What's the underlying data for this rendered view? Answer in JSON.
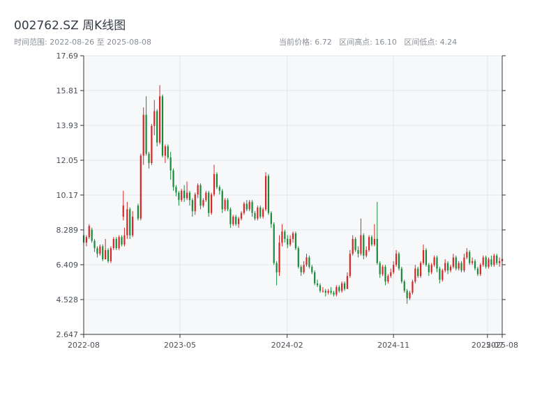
{
  "header": {
    "title": "002762.SZ 周K线图",
    "date_range": "时间范围: 2022-08-26 至 2025-08-08",
    "current_price": "当前价格: 6.72",
    "range_high": "区间高点: 16.10",
    "range_low": "区间低点: 4.24"
  },
  "colors": {
    "up": "#d62728",
    "down": "#1a8a3a",
    "grid": "#e3e6ea",
    "plot_bg": "#f7f8fa",
    "axis": "#333333"
  },
  "chart_data": {
    "type": "candlestick",
    "title": "002762.SZ 周K线图",
    "ylim": [
      2.647,
      17.69
    ],
    "xlim": [
      "2022-08-26",
      "2025-08-08"
    ],
    "y_ticks": [
      "2.647",
      "4.528",
      "6.409",
      "8.289",
      "10.17",
      "12.05",
      "13.93",
      "15.81",
      "17.69"
    ],
    "x_ticks": [
      {
        "label": "2022-08",
        "date": "2022-08-26"
      },
      {
        "label": "2023-05",
        "date": "2023-05-01"
      },
      {
        "label": "2024-02",
        "date": "2024-02-01"
      },
      {
        "label": "2024-11",
        "date": "2024-11-01"
      },
      {
        "label": "2025-07",
        "date": "2025-07-01"
      },
      {
        "label": "2025-08",
        "date": "2025-08-08"
      }
    ],
    "candles": [
      [
        "2022-08-26",
        8.0,
        7.6,
        8.1,
        7.5
      ],
      [
        "2022-09-02",
        7.6,
        7.9,
        8.0,
        7.4
      ],
      [
        "2022-09-09",
        7.9,
        8.5,
        8.6,
        7.8
      ],
      [
        "2022-09-16",
        8.3,
        7.7,
        8.4,
        7.6
      ],
      [
        "2022-09-23",
        7.7,
        7.3,
        7.8,
        7.1
      ],
      [
        "2022-09-30",
        7.3,
        7.0,
        7.4,
        6.8
      ],
      [
        "2022-10-07",
        7.0,
        7.4,
        7.5,
        6.9
      ],
      [
        "2022-10-14",
        7.4,
        6.7,
        7.5,
        6.6
      ],
      [
        "2022-10-21",
        6.7,
        7.2,
        7.8,
        6.7
      ],
      [
        "2022-10-28",
        7.2,
        6.6,
        7.3,
        6.5
      ],
      [
        "2022-11-04",
        6.6,
        7.3,
        7.4,
        6.5
      ],
      [
        "2022-11-11",
        7.3,
        7.8,
        7.9,
        7.2
      ],
      [
        "2022-11-18",
        7.8,
        7.3,
        7.9,
        7.2
      ],
      [
        "2022-11-25",
        7.3,
        7.9,
        8.0,
        7.2
      ],
      [
        "2022-12-02",
        7.9,
        7.5,
        8.0,
        7.4
      ],
      [
        "2022-12-09",
        7.5,
        8.0,
        8.4,
        7.4
      ],
      [
        "2022-12-16",
        8.0,
        9.4,
        9.8,
        7.8
      ],
      [
        "2022-12-23",
        9.4,
        8.0,
        9.5,
        7.8
      ],
      [
        "2022-12-30",
        8.0,
        9.0,
        9.3,
        7.9
      ],
      [
        "2022-12-06",
        9.0,
        9.6,
        10.4,
        8.8
      ],
      [
        "2023-01-13",
        9.6,
        8.9,
        9.7,
        8.8
      ],
      [
        "2023-01-20",
        8.9,
        12.3,
        12.4,
        8.8
      ],
      [
        "2023-01-27",
        12.3,
        14.5,
        14.9,
        11.8
      ],
      [
        "2023-02-03",
        14.5,
        12.4,
        15.5,
        12.3
      ],
      [
        "2023-02-10",
        12.4,
        11.9,
        12.5,
        11.6
      ],
      [
        "2023-02-17",
        11.9,
        13.9,
        14.0,
        11.8
      ],
      [
        "2023-02-24",
        13.9,
        14.7,
        15.3,
        13.4
      ],
      [
        "2023-03-03",
        14.7,
        13.0,
        14.8,
        12.8
      ],
      [
        "2023-03-10",
        13.0,
        15.5,
        16.1,
        12.9
      ],
      [
        "2023-03-17",
        15.5,
        12.3,
        15.6,
        12.2
      ],
      [
        "2023-03-24",
        12.3,
        12.8,
        12.9,
        11.9
      ],
      [
        "2023-03-31",
        12.8,
        12.2,
        12.9,
        12.1
      ],
      [
        "2023-04-07",
        12.2,
        11.5,
        12.5,
        11.0
      ],
      [
        "2023-04-14",
        11.5,
        10.6,
        11.6,
        10.4
      ],
      [
        "2023-04-21",
        10.6,
        10.3,
        10.7,
        10.1
      ],
      [
        "2023-04-28",
        10.3,
        9.9,
        10.4,
        9.6
      ],
      [
        "2023-05-05",
        9.9,
        10.4,
        10.5,
        9.8
      ],
      [
        "2023-05-12",
        10.4,
        10.0,
        10.7,
        9.8
      ],
      [
        "2023-05-19",
        10.0,
        10.3,
        10.9,
        9.9
      ],
      [
        "2023-05-26",
        10.3,
        9.9,
        10.4,
        9.6
      ],
      [
        "2023-06-02",
        9.9,
        9.3,
        10.0,
        9.0
      ],
      [
        "2023-06-09",
        9.3,
        10.2,
        10.3,
        9.1
      ],
      [
        "2023-06-16",
        10.2,
        10.7,
        10.8,
        10.0
      ],
      [
        "2023-06-23",
        10.7,
        9.6,
        10.8,
        9.4
      ],
      [
        "2023-06-30",
        9.6,
        9.9,
        10.0,
        9.5
      ],
      [
        "2023-07-07",
        9.9,
        10.3,
        10.4,
        9.8
      ],
      [
        "2023-07-14",
        10.3,
        9.2,
        10.4,
        9.0
      ],
      [
        "2023-07-21",
        9.2,
        10.2,
        10.3,
        9.1
      ],
      [
        "2023-07-28",
        10.2,
        11.3,
        11.8,
        10.1
      ],
      [
        "2023-08-04",
        11.3,
        10.6,
        11.4,
        10.5
      ],
      [
        "2023-08-11",
        10.6,
        10.4,
        10.7,
        10.2
      ],
      [
        "2023-08-18",
        10.4,
        9.4,
        10.5,
        9.2
      ],
      [
        "2023-08-25",
        9.4,
        9.9,
        10.0,
        9.3
      ],
      [
        "2023-09-01",
        9.9,
        9.4,
        10.0,
        9.3
      ],
      [
        "2023-09-08",
        9.4,
        8.6,
        9.5,
        8.4
      ],
      [
        "2023-09-15",
        8.6,
        9.0,
        9.1,
        8.5
      ],
      [
        "2023-09-22",
        9.0,
        8.6,
        9.1,
        8.5
      ],
      [
        "2023-09-29",
        8.6,
        8.9,
        9.0,
        8.4
      ],
      [
        "2023-10-06",
        8.9,
        9.2,
        9.3,
        8.8
      ],
      [
        "2023-10-13",
        9.2,
        9.7,
        9.8,
        9.1
      ],
      [
        "2023-10-20",
        9.7,
        9.4,
        9.9,
        9.3
      ],
      [
        "2023-10-27",
        9.4,
        9.8,
        9.9,
        9.3
      ],
      [
        "2023-11-03",
        9.8,
        9.2,
        9.9,
        9.0
      ],
      [
        "2023-11-10",
        9.2,
        8.9,
        9.3,
        8.8
      ],
      [
        "2023-11-17",
        8.9,
        9.5,
        9.6,
        8.8
      ],
      [
        "2023-11-24",
        9.5,
        9.0,
        9.6,
        8.9
      ],
      [
        "2023-12-01",
        9.0,
        9.4,
        9.5,
        8.9
      ],
      [
        "2023-12-08",
        9.4,
        11.2,
        11.4,
        9.3
      ],
      [
        "2023-12-15",
        11.2,
        9.2,
        11.3,
        9.1
      ],
      [
        "2023-12-22",
        9.2,
        8.6,
        9.3,
        8.4
      ],
      [
        "2023-12-29",
        8.6,
        6.5,
        8.7,
        6.4
      ],
      [
        "2024-01-05",
        6.5,
        6.0,
        6.6,
        5.3
      ],
      [
        "2024-01-12",
        6.0,
        7.6,
        8.0,
        5.8
      ],
      [
        "2024-01-19",
        7.6,
        8.2,
        8.6,
        7.4
      ],
      [
        "2024-01-26",
        8.2,
        7.8,
        8.3,
        7.6
      ],
      [
        "2024-02-02",
        7.8,
        7.5,
        8.0,
        7.3
      ],
      [
        "2024-02-09",
        7.5,
        7.8,
        8.0,
        7.4
      ],
      [
        "2024-02-16",
        7.8,
        8.1,
        8.2,
        7.6
      ],
      [
        "2024-02-23",
        8.1,
        7.3,
        8.2,
        7.2
      ],
      [
        "2024-03-01",
        7.3,
        6.3,
        7.4,
        6.2
      ],
      [
        "2024-03-08",
        6.3,
        6.0,
        6.4,
        5.8
      ],
      [
        "2024-03-15",
        6.0,
        6.4,
        6.6,
        5.9
      ],
      [
        "2024-03-22",
        6.4,
        6.8,
        7.0,
        6.3
      ],
      [
        "2024-03-29",
        6.8,
        6.3,
        6.9,
        6.2
      ],
      [
        "2024-04-05",
        6.3,
        6.0,
        6.4,
        5.9
      ],
      [
        "2024-04-12",
        6.0,
        5.4,
        6.1,
        5.3
      ],
      [
        "2024-04-19",
        5.4,
        5.3,
        5.6,
        5.2
      ],
      [
        "2024-04-26",
        5.3,
        5.0,
        5.4,
        4.9
      ],
      [
        "2024-05-03",
        5.0,
        5.0,
        5.2,
        4.9
      ],
      [
        "2024-05-10",
        5.0,
        4.9,
        5.1,
        4.7
      ],
      [
        "2024-05-17",
        4.9,
        5.0,
        5.1,
        4.8
      ],
      [
        "2024-05-24",
        5.0,
        4.9,
        5.2,
        4.8
      ],
      [
        "2024-05-31",
        4.9,
        4.8,
        5.0,
        4.7
      ],
      [
        "2024-06-07",
        4.8,
        5.2,
        5.3,
        4.7
      ],
      [
        "2024-06-14",
        5.2,
        5.0,
        5.3,
        4.9
      ],
      [
        "2024-06-21",
        5.0,
        5.4,
        5.5,
        4.9
      ],
      [
        "2024-06-28",
        5.4,
        5.1,
        5.5,
        5.0
      ],
      [
        "2024-07-05",
        5.1,
        5.8,
        6.0,
        5.1
      ],
      [
        "2024-07-12",
        5.8,
        7.0,
        7.2,
        5.7
      ],
      [
        "2024-07-19",
        7.0,
        7.8,
        8.0,
        6.9
      ],
      [
        "2024-07-26",
        7.8,
        7.2,
        7.9,
        7.1
      ],
      [
        "2024-08-02",
        7.2,
        7.0,
        7.4,
        6.8
      ],
      [
        "2024-08-09",
        7.0,
        8.0,
        8.9,
        6.9
      ],
      [
        "2024-08-16",
        8.0,
        6.9,
        8.1,
        6.7
      ],
      [
        "2024-08-23",
        6.9,
        7.2,
        7.4,
        6.8
      ],
      [
        "2024-08-30",
        7.2,
        7.9,
        8.0,
        7.1
      ],
      [
        "2024-09-06",
        7.9,
        7.5,
        8.0,
        7.4
      ],
      [
        "2024-09-13",
        7.5,
        7.8,
        8.6,
        7.4
      ],
      [
        "2024-09-20",
        7.8,
        6.5,
        9.8,
        6.4
      ],
      [
        "2024-09-27",
        6.5,
        5.9,
        6.6,
        5.7
      ],
      [
        "2024-10-04",
        5.9,
        6.3,
        6.4,
        5.8
      ],
      [
        "2024-10-11",
        6.3,
        5.5,
        6.4,
        5.3
      ],
      [
        "2024-10-18",
        5.5,
        5.8,
        5.9,
        5.4
      ],
      [
        "2024-10-25",
        5.8,
        6.0,
        6.2,
        5.7
      ],
      [
        "2024-11-01",
        6.0,
        6.4,
        6.6,
        5.9
      ],
      [
        "2024-11-08",
        6.4,
        7.0,
        7.2,
        6.3
      ],
      [
        "2024-11-15",
        7.0,
        6.2,
        7.1,
        6.1
      ],
      [
        "2024-11-22",
        6.2,
        5.5,
        6.3,
        5.4
      ],
      [
        "2024-11-29",
        5.5,
        5.0,
        5.6,
        4.9
      ],
      [
        "2024-12-06",
        5.0,
        4.6,
        5.1,
        4.3
      ],
      [
        "2024-12-13",
        4.6,
        4.9,
        5.0,
        4.5
      ],
      [
        "2024-12-20",
        4.9,
        5.5,
        5.6,
        4.8
      ],
      [
        "2024-12-27",
        5.5,
        6.2,
        6.4,
        5.4
      ],
      [
        "2025-01-03",
        6.2,
        5.8,
        6.3,
        5.7
      ],
      [
        "2025-01-10",
        5.8,
        6.5,
        6.6,
        5.7
      ],
      [
        "2025-01-17",
        6.5,
        7.2,
        7.5,
        6.4
      ],
      [
        "2025-01-24",
        7.2,
        6.4,
        7.3,
        6.3
      ],
      [
        "2025-01-31",
        6.4,
        6.0,
        6.5,
        5.8
      ],
      [
        "2025-02-07",
        6.0,
        6.4,
        6.5,
        5.9
      ],
      [
        "2025-02-14",
        6.4,
        6.8,
        6.9,
        6.3
      ],
      [
        "2025-02-21",
        6.8,
        6.2,
        6.9,
        6.0
      ],
      [
        "2025-02-28",
        6.2,
        5.6,
        6.3,
        5.4
      ],
      [
        "2025-03-07",
        5.6,
        6.1,
        6.2,
        5.5
      ],
      [
        "2025-03-14",
        6.1,
        6.5,
        6.7,
        6.0
      ],
      [
        "2025-03-21",
        6.5,
        6.1,
        6.6,
        5.9
      ],
      [
        "2025-03-28",
        6.1,
        6.3,
        6.4,
        6.0
      ],
      [
        "2025-04-04",
        6.3,
        6.8,
        7.0,
        6.2
      ],
      [
        "2025-04-11",
        6.8,
        6.2,
        6.9,
        6.1
      ],
      [
        "2025-04-18",
        6.2,
        6.5,
        6.6,
        6.1
      ],
      [
        "2025-04-25",
        6.5,
        6.1,
        6.6,
        6.0
      ],
      [
        "2025-05-02",
        6.1,
        6.8,
        7.0,
        6.0
      ],
      [
        "2025-05-09",
        6.8,
        7.1,
        7.3,
        6.7
      ],
      [
        "2025-05-16",
        7.1,
        6.5,
        7.2,
        6.4
      ],
      [
        "2025-05-23",
        6.5,
        6.6,
        6.8,
        6.4
      ],
      [
        "2025-05-30",
        6.6,
        6.2,
        6.7,
        6.1
      ],
      [
        "2025-06-06",
        6.2,
        5.9,
        6.3,
        5.8
      ],
      [
        "2025-06-13",
        5.9,
        6.4,
        6.5,
        5.8
      ],
      [
        "2025-06-20",
        6.4,
        6.8,
        6.9,
        6.3
      ],
      [
        "2025-06-27",
        6.8,
        6.3,
        6.9,
        6.2
      ],
      [
        "2025-07-04",
        6.3,
        6.7,
        6.8,
        6.2
      ],
      [
        "2025-07-11",
        6.7,
        6.4,
        6.9,
        6.3
      ],
      [
        "2025-07-18",
        6.4,
        6.9,
        7.0,
        6.3
      ],
      [
        "2025-07-25",
        6.9,
        6.5,
        7.0,
        6.4
      ],
      [
        "2025-08-01",
        6.5,
        6.6,
        6.8,
        6.3
      ],
      [
        "2025-08-08",
        6.6,
        6.72,
        6.9,
        6.5
      ]
    ]
  }
}
